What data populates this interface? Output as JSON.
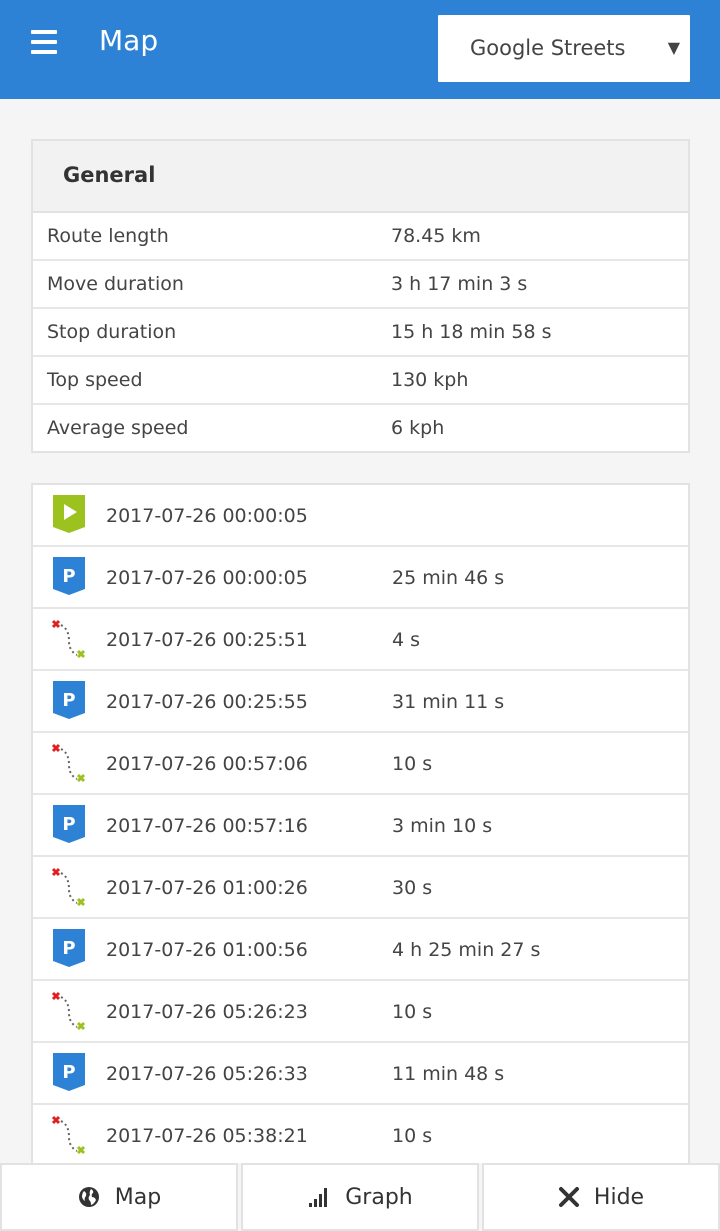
{
  "header": {
    "title": "Map",
    "layer_select": {
      "selected": "Google Streets"
    }
  },
  "general": {
    "title": "General",
    "stats": [
      {
        "label": "Route length",
        "value": "78.45 km"
      },
      {
        "label": "Move duration",
        "value": "3 h 17 min 3 s"
      },
      {
        "label": "Stop duration",
        "value": "15 h 18 min 58 s"
      },
      {
        "label": "Top speed",
        "value": "130 kph"
      },
      {
        "label": "Average speed",
        "value": "6 kph"
      }
    ]
  },
  "events": [
    {
      "icon": "route-start-icon",
      "time": "2017-07-26 00:00:05",
      "duration": ""
    },
    {
      "icon": "parking-icon",
      "time": "2017-07-26 00:00:05",
      "duration": "25 min 46 s"
    },
    {
      "icon": "drive-segment-icon",
      "time": "2017-07-26 00:25:51",
      "duration": "4 s"
    },
    {
      "icon": "parking-icon",
      "time": "2017-07-26 00:25:55",
      "duration": "31 min 11 s"
    },
    {
      "icon": "drive-segment-icon",
      "time": "2017-07-26 00:57:06",
      "duration": "10 s"
    },
    {
      "icon": "parking-icon",
      "time": "2017-07-26 00:57:16",
      "duration": "3 min 10 s"
    },
    {
      "icon": "drive-segment-icon",
      "time": "2017-07-26 01:00:26",
      "duration": "30 s"
    },
    {
      "icon": "parking-icon",
      "time": "2017-07-26 01:00:56",
      "duration": "4 h 25 min 27 s"
    },
    {
      "icon": "drive-segment-icon",
      "time": "2017-07-26 05:26:23",
      "duration": "10 s"
    },
    {
      "icon": "parking-icon",
      "time": "2017-07-26 05:26:33",
      "duration": "11 min 48 s"
    },
    {
      "icon": "drive-segment-icon",
      "time": "2017-07-26 05:38:21",
      "duration": "10 s"
    }
  ],
  "bottom_nav": {
    "map_label": "Map",
    "graph_label": "Graph",
    "hide_label": "Hide"
  },
  "colors": {
    "header_bg": "#2d82d6",
    "start_green": "#9bc21f",
    "parking_blue": "#2d82d6",
    "drive_red": "#e02020",
    "drive_green": "#9bc21f"
  }
}
